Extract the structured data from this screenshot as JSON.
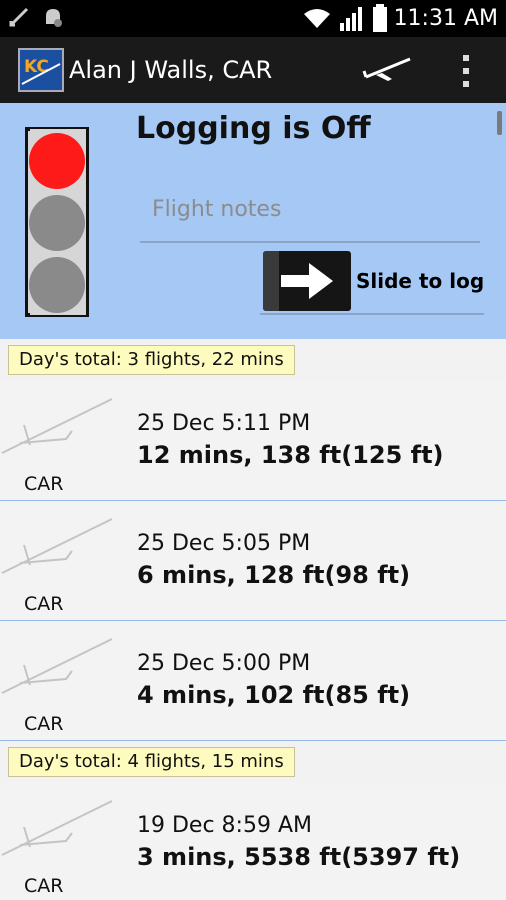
{
  "status_bar": {
    "time": "11:31 AM",
    "icons": [
      "missed-call-icon",
      "notification-icon",
      "wifi-icon",
      "signal-icon",
      "battery-icon"
    ]
  },
  "action_bar": {
    "title": "Alan J Walls, CAR",
    "logo_icon": "app-logo-icon",
    "actions": [
      "glider-icon",
      "overflow-menu-icon"
    ]
  },
  "header": {
    "logging_status": "Logging is Off",
    "light_state": "red",
    "notes_placeholder": "Flight notes",
    "notes_value": "",
    "slide_label": "Slide to log"
  },
  "days": [
    {
      "total": "Day's total: 3 flights, 22 mins",
      "flights": [
        {
          "glider": "CAR",
          "datetime": "25 Dec 5:11 PM",
          "stats": "12 mins,   138 ft(125 ft)"
        },
        {
          "glider": "CAR",
          "datetime": "25 Dec 5:05 PM",
          "stats": "6 mins,   128 ft(98 ft)"
        },
        {
          "glider": "CAR",
          "datetime": "25 Dec 5:00 PM",
          "stats": "4 mins,   102 ft(85 ft)"
        }
      ]
    },
    {
      "total": "Day's total: 4 flights, 15 mins",
      "flights": [
        {
          "glider": "CAR",
          "datetime": "19 Dec 8:59 AM",
          "stats": "3 mins,   5538 ft(5397 ft)"
        }
      ]
    }
  ],
  "colors": {
    "header_bg": "#a6c8f5",
    "badge_bg": "#fdfbbd",
    "divider": "#94b7e8",
    "red_light": "#ff1a1a"
  }
}
